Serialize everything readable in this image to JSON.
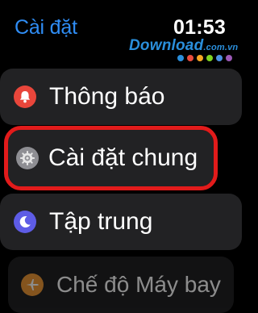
{
  "header": {
    "back_title": "Cài đặt",
    "time": "01:53"
  },
  "watermark": {
    "text": "Download",
    "suffix": ".com.vn",
    "dot_colors": [
      "#2a8fdc",
      "#e84c3d",
      "#f5a623",
      "#7ed321",
      "#4a90e2",
      "#9b59b6"
    ]
  },
  "settings": {
    "items": [
      {
        "label": "Thông báo",
        "icon": "bell-icon",
        "icon_color": "#e9463b",
        "highlighted": false
      },
      {
        "label": "Cài đặt chung",
        "icon": "gear-icon",
        "icon_color": "#8e8e93",
        "highlighted": true
      },
      {
        "label": "Tập trung",
        "icon": "moon-icon",
        "icon_color": "#5e5ce6",
        "highlighted": false
      },
      {
        "label": "Chế độ Máy bay",
        "icon": "airplane-icon",
        "icon_color": "#f09a37",
        "highlighted": false
      }
    ]
  },
  "colors": {
    "accent": "#2f8df5",
    "row_bg": "#222224",
    "highlight_outline": "#e21b1b"
  }
}
